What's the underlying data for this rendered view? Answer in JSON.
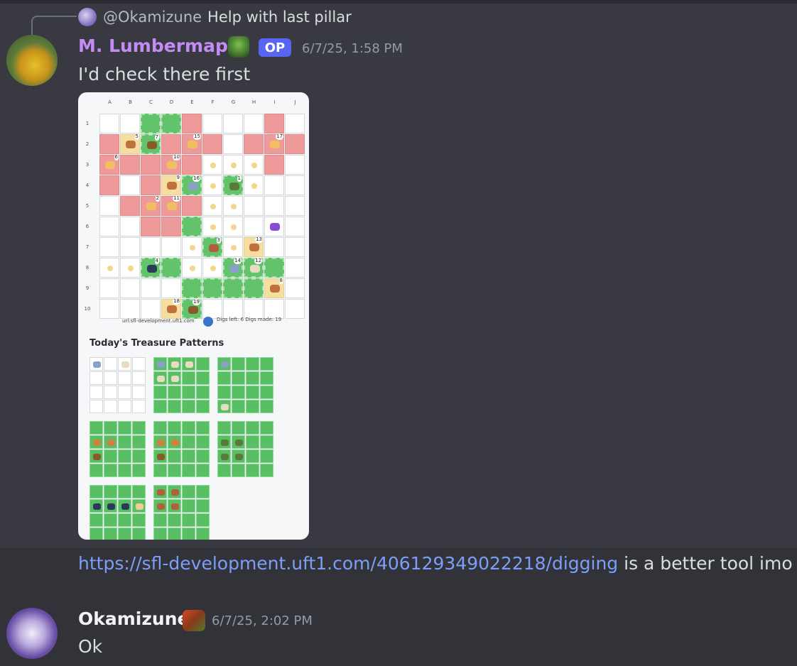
{
  "reply": {
    "user": "@Okamizune",
    "text": "Help with last pillar"
  },
  "message1": {
    "author": "M. Lumbermaph",
    "op_badge": "OP",
    "timestamp": "6/7/25, 1:58 PM",
    "text": "I'd check there first"
  },
  "embed_image": {
    "columns": [
      "A",
      "B",
      "C",
      "D",
      "E",
      "F",
      "G",
      "H",
      "I",
      "J"
    ],
    "rows": [
      "1",
      "2",
      "3",
      "4",
      "5",
      "6",
      "7",
      "8",
      "9",
      "10"
    ],
    "footer_url": "url:sfl-development.uft1.com",
    "footer_digs": "Digs left: 6 Digs made: 19",
    "patterns_title": "Today's Treasure Patterns"
  },
  "message2": {
    "link": "https://sfl-development.uft1.com/406129349022218/digging",
    "after_link": " is a better tool imo"
  },
  "message3": {
    "author": "Okamizune",
    "timestamp": "6/7/25, 2:02 PM",
    "text": "Ok"
  },
  "colors": {
    "background": "#323339",
    "highlight": "#393a41",
    "author1": "#c38cf5",
    "op_badge": "#5865f2",
    "link": "#00a8fc"
  }
}
